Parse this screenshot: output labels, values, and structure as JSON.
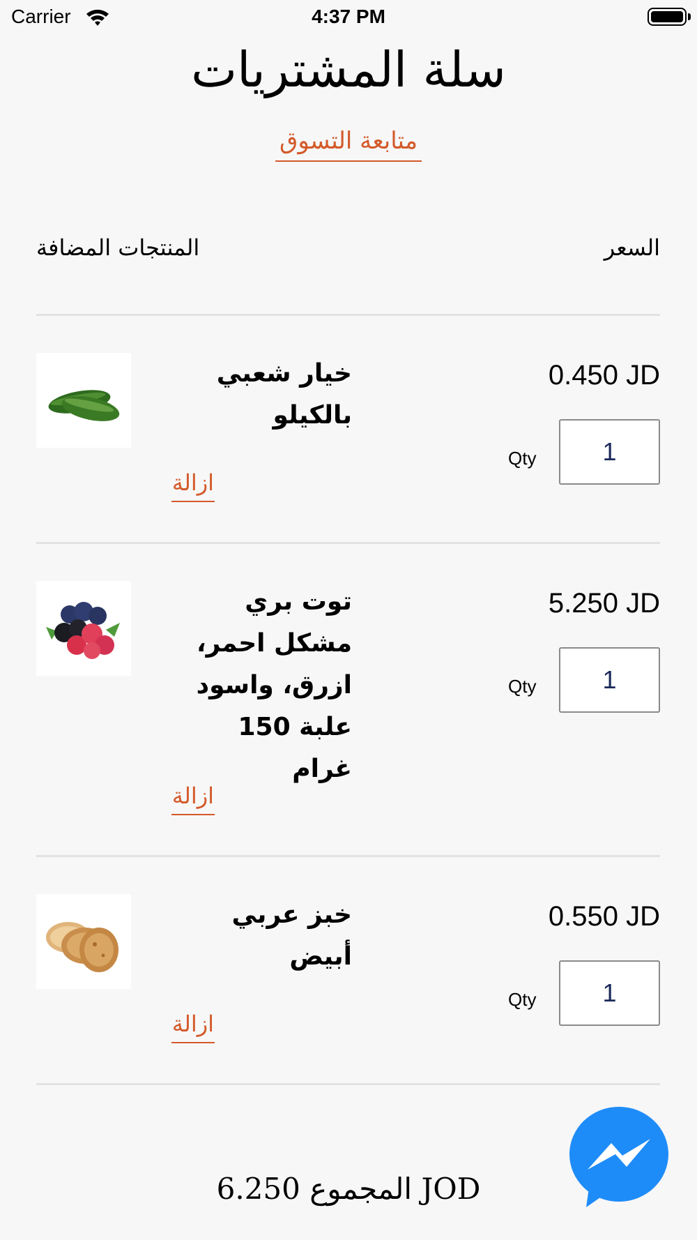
{
  "status_bar": {
    "carrier": "Carrier",
    "time": "4:37 PM"
  },
  "header": {
    "title": "سلة المشتريات",
    "continue_shopping": "متابعة التسوق"
  },
  "columns": {
    "products": "المنتجات المضافة",
    "price": "السعر"
  },
  "items": [
    {
      "image_icon": "cucumber-image",
      "name_lines": [
        "خيار شعبي",
        "بالكيلو"
      ],
      "price": "0.450 JD",
      "qty_label": "Qty",
      "qty": "1",
      "remove": "ازالة"
    },
    {
      "image_icon": "berries-image",
      "name_lines": [
        "توت بري",
        "مشكل احمر،",
        "ازرق، واسود",
        "علبة 150 غرام"
      ],
      "price": "5.250 JD",
      "qty_label": "Qty",
      "qty": "1",
      "remove": "ازالة"
    },
    {
      "image_icon": "arabic-bread-image",
      "name_lines": [
        "خبز عربي",
        "أبيض"
      ],
      "price": "0.550 JD",
      "qty_label": "Qty",
      "qty": "1",
      "remove": "ازالة"
    }
  ],
  "total": "6.250 المجموع JOD",
  "colors": {
    "accent": "#d35a2a",
    "messenger": "#1e8cf8",
    "background": "#f7f7f7"
  }
}
